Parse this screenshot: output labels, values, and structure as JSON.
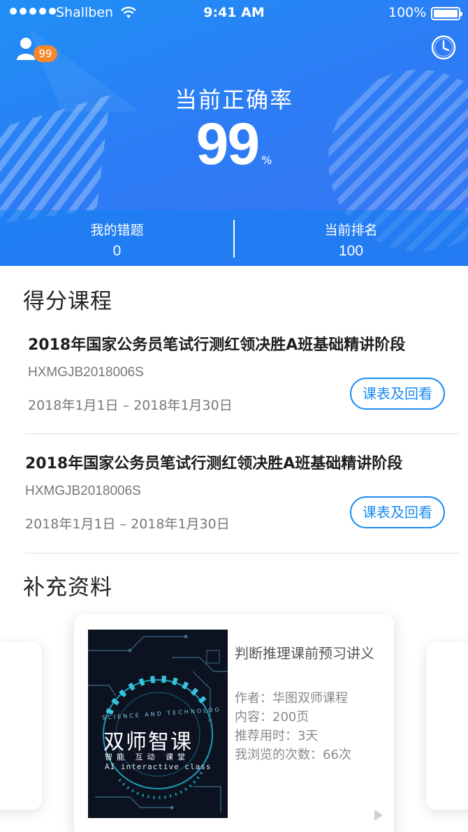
{
  "status_bar": {
    "carrier": "Shallben",
    "time": "9:41 AM",
    "battery": "100%"
  },
  "header": {
    "user_badge": "99",
    "accuracy_label": "当前正确率",
    "accuracy_value": "99",
    "accuracy_unit": "%",
    "stats": [
      {
        "label": "我的错题",
        "value": "0"
      },
      {
        "label": "当前排名",
        "value": "100"
      }
    ]
  },
  "scored_courses": {
    "title": "得分课程",
    "items": [
      {
        "title": "2018年国家公务员笔试行测红领决胜A班基础精讲阶段",
        "code": "HXMGJB2018006S",
        "date": "2018年1月1日 – 2018年1月30日",
        "button": "课表及回看"
      },
      {
        "title": "2018年国家公务员笔试行测红领决胜A班基础精讲阶段",
        "code": "HXMGJB2018006S",
        "date": "2018年1月1日 – 2018年1月30日",
        "button": "课表及回看"
      }
    ]
  },
  "materials": {
    "title": "补充资料",
    "book": {
      "cover_small": "SCIENCE AND TECHNOLOG",
      "cover_title": "双师智课",
      "cover_subtitle": "智能 互动 课堂",
      "cover_english": "AI interactive class",
      "title": "判断推理课前预习讲义",
      "author": "作者：华图双师课程",
      "content": "内容：200页",
      "duration": "推荐用时：3天",
      "views": "我浏览的次数：66次"
    }
  },
  "icons": {
    "user": "user-icon",
    "clock": "clock-icon",
    "wifi": "wifi-icon",
    "play": "play-icon"
  },
  "colors": {
    "primary": "#1a8cf0",
    "badge": "#f6872a"
  }
}
